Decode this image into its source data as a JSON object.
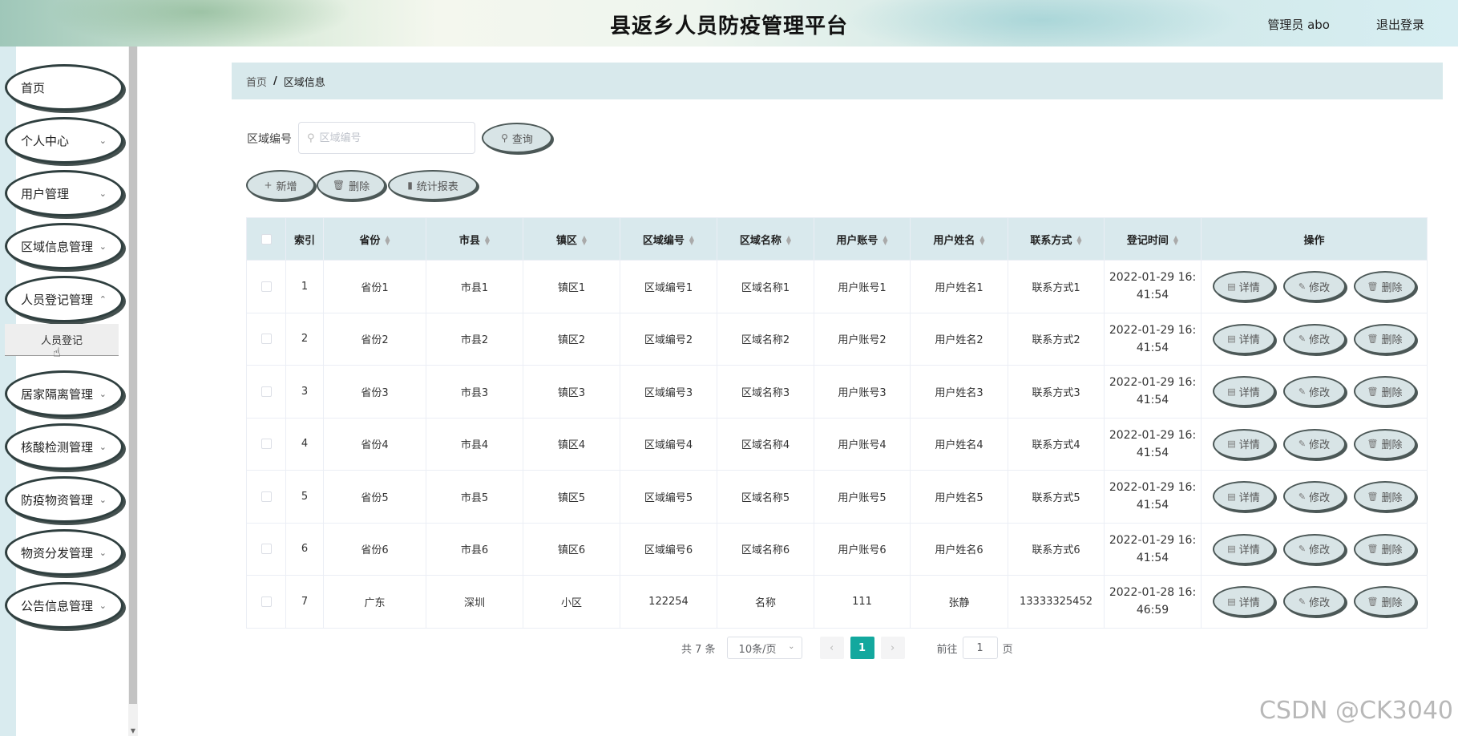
{
  "header": {
    "title": "县返乡人员防疫管理平台",
    "user": "管理员 abo",
    "logout": "退出登录"
  },
  "sidebar": {
    "items": [
      {
        "label": "首页",
        "expandable": false
      },
      {
        "label": "个人中心",
        "expandable": true
      },
      {
        "label": "用户管理",
        "expandable": true
      },
      {
        "label": "区域信息管理",
        "expandable": true
      },
      {
        "label": "人员登记管理",
        "expandable": true
      },
      {
        "label": "居家隔离管理",
        "expandable": true
      },
      {
        "label": "核酸检测管理",
        "expandable": true
      },
      {
        "label": "防疫物资管理",
        "expandable": true
      },
      {
        "label": "物资分发管理",
        "expandable": true
      },
      {
        "label": "公告信息管理",
        "expandable": true
      }
    ],
    "submenu_label": "人员登记"
  },
  "breadcrumb": {
    "home": "首页",
    "separator": "/",
    "current": "区域信息"
  },
  "search": {
    "label": "区域编号",
    "placeholder": "区域编号",
    "button": "查询"
  },
  "toolbar": {
    "add": "新增",
    "delete": "删除",
    "report": "统计报表"
  },
  "table": {
    "columns": [
      "索引",
      "省份",
      "市县",
      "镇区",
      "区域编号",
      "区域名称",
      "用户账号",
      "用户姓名",
      "联系方式",
      "登记时间",
      "操作"
    ],
    "rows": [
      {
        "index": "1",
        "province": "省份1",
        "city": "市县1",
        "town": "镇区1",
        "code": "区域编号1",
        "name": "区域名称1",
        "account": "用户账号1",
        "username": "用户姓名1",
        "contact": "联系方式1",
        "time": [
          "2022-01-29 16:",
          "41:54"
        ]
      },
      {
        "index": "2",
        "province": "省份2",
        "city": "市县2",
        "town": "镇区2",
        "code": "区域编号2",
        "name": "区域名称2",
        "account": "用户账号2",
        "username": "用户姓名2",
        "contact": "联系方式2",
        "time": [
          "2022-01-29 16:",
          "41:54"
        ]
      },
      {
        "index": "3",
        "province": "省份3",
        "city": "市县3",
        "town": "镇区3",
        "code": "区域编号3",
        "name": "区域名称3",
        "account": "用户账号3",
        "username": "用户姓名3",
        "contact": "联系方式3",
        "time": [
          "2022-01-29 16:",
          "41:54"
        ]
      },
      {
        "index": "4",
        "province": "省份4",
        "city": "市县4",
        "town": "镇区4",
        "code": "区域编号4",
        "name": "区域名称4",
        "account": "用户账号4",
        "username": "用户姓名4",
        "contact": "联系方式4",
        "time": [
          "2022-01-29 16:",
          "41:54"
        ]
      },
      {
        "index": "5",
        "province": "省份5",
        "city": "市县5",
        "town": "镇区5",
        "code": "区域编号5",
        "name": "区域名称5",
        "account": "用户账号5",
        "username": "用户姓名5",
        "contact": "联系方式5",
        "time": [
          "2022-01-29 16:",
          "41:54"
        ]
      },
      {
        "index": "6",
        "province": "省份6",
        "city": "市县6",
        "town": "镇区6",
        "code": "区域编号6",
        "name": "区域名称6",
        "account": "用户账号6",
        "username": "用户姓名6",
        "contact": "联系方式6",
        "time": [
          "2022-01-29 16:",
          "41:54"
        ]
      },
      {
        "index": "7",
        "province": "广东",
        "city": "深圳",
        "town": "小区",
        "code": "122254",
        "name": "名称",
        "account": "111",
        "username": "张静",
        "contact": "13333325452",
        "time": [
          "2022-01-28 16:",
          "46:59"
        ]
      }
    ],
    "actions": {
      "detail": "详情",
      "edit": "修改",
      "delete": "删除"
    }
  },
  "pagination": {
    "total": "共 7 条",
    "page_size": "10条/页",
    "current_page": "1",
    "goto_prefix": "前往",
    "goto_value": "1",
    "goto_suffix": "页"
  },
  "watermark": "CSDN @CK3040",
  "colors": {
    "accent": "#13a89e",
    "header_bg": "#d8e9ec",
    "pill_bg": "#d8e4e6"
  }
}
